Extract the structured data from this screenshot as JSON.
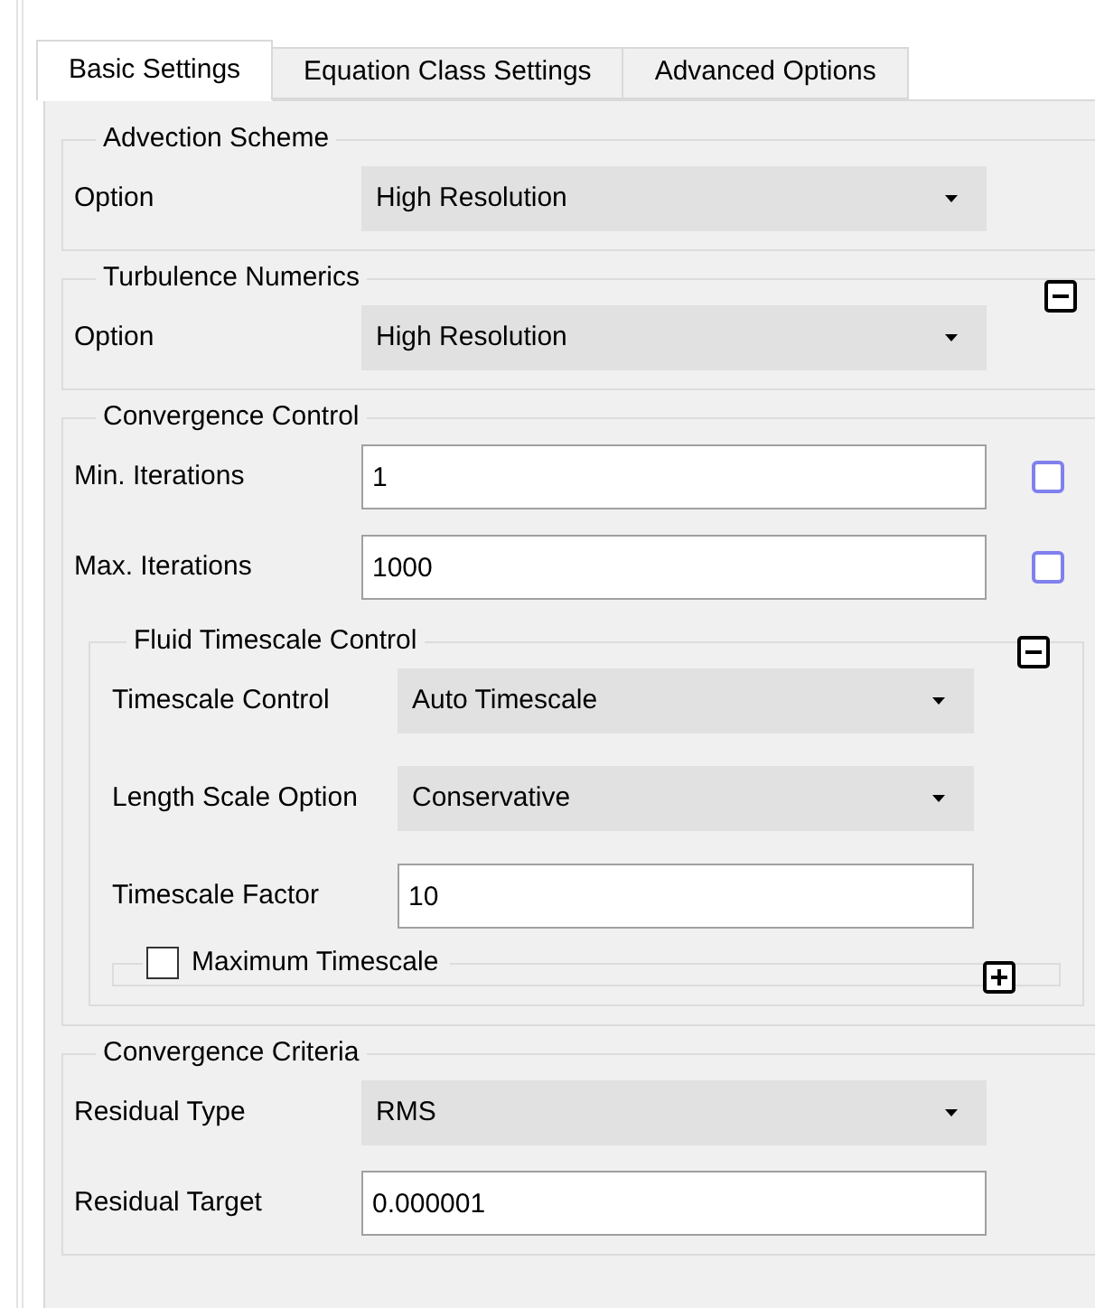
{
  "tabs": [
    {
      "label": "Basic Settings",
      "selected": true
    },
    {
      "label": "Equation Class Settings",
      "selected": false
    },
    {
      "label": "Advanced Options",
      "selected": false
    }
  ],
  "groups": [
    {
      "title": "Advection Scheme",
      "rows": [
        {
          "kind": "dropdown",
          "label": "Option",
          "value": "High Resolution"
        }
      ]
    },
    {
      "title": "Turbulence Numerics",
      "expanded": true,
      "rows": [
        {
          "kind": "dropdown",
          "label": "Option",
          "value": "High Resolution"
        }
      ]
    },
    {
      "title": "Convergence Control",
      "rows": [
        {
          "kind": "input",
          "label": "Min. Iterations",
          "value": "1",
          "checked": false
        },
        {
          "kind": "input",
          "label": "Max. Iterations",
          "value": "1000",
          "checked": false
        },
        {
          "kind": "subgroup",
          "title": "Fluid Timescale Control",
          "expanded": true,
          "rows": [
            {
              "kind": "dropdown",
              "label": "Timescale Control",
              "value": "Auto Timescale"
            },
            {
              "kind": "dropdown",
              "label": "Length Scale Option",
              "value": "Conservative"
            },
            {
              "kind": "input",
              "label": "Timescale Factor",
              "value": "10"
            },
            {
              "kind": "check_group",
              "label": "Maximum Timescale",
              "checked": false,
              "expanded": false
            }
          ]
        }
      ]
    },
    {
      "title": "Convergence Criteria",
      "rows": [
        {
          "kind": "dropdown",
          "label": "Residual Type",
          "value": "RMS"
        },
        {
          "kind": "input",
          "label": "Residual Target",
          "value": "0.000001"
        }
      ]
    }
  ]
}
